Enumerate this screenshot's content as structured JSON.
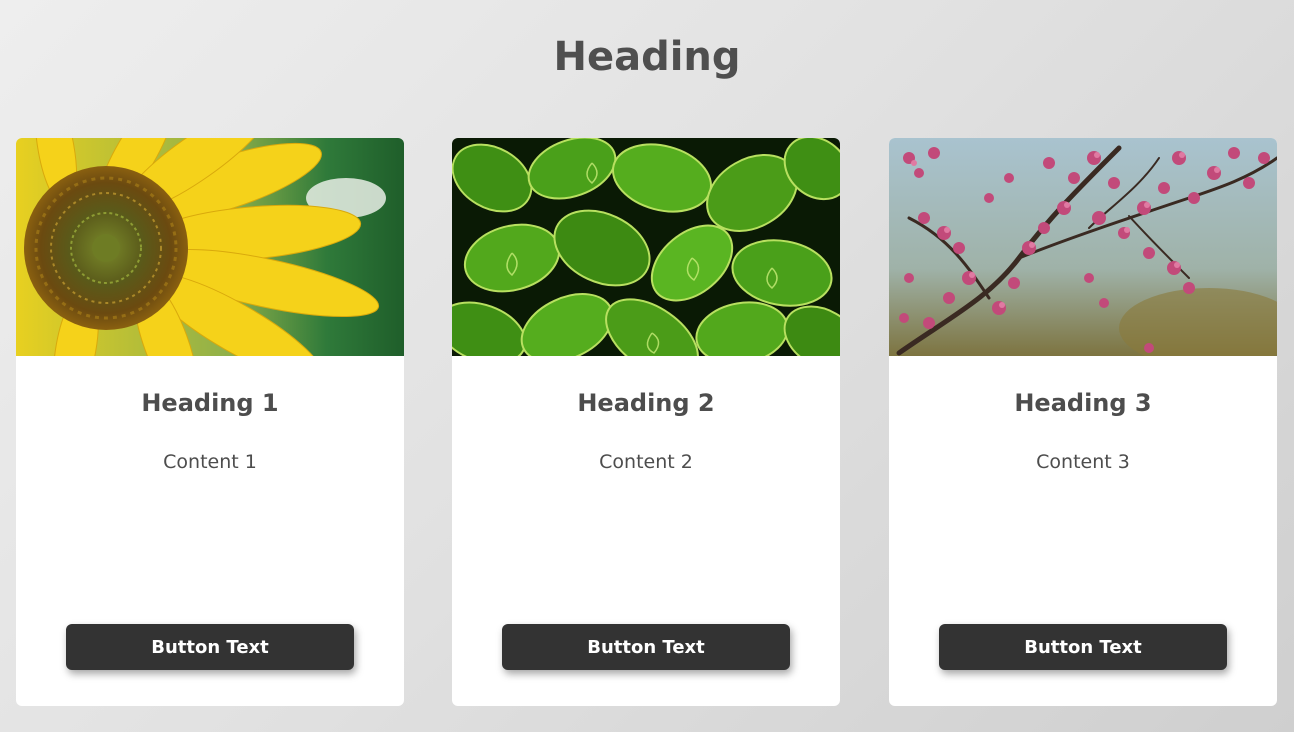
{
  "page": {
    "title": "Heading"
  },
  "cards": [
    {
      "heading": "Heading 1",
      "content": "Content 1",
      "button_label": "Button Text",
      "image": "sunflower"
    },
    {
      "heading": "Heading 2",
      "content": "Content 2",
      "button_label": "Button Text",
      "image": "green-leaves"
    },
    {
      "heading": "Heading 3",
      "content": "Content 3",
      "button_label": "Button Text",
      "image": "pink-blossom-branch"
    }
  ],
  "colors": {
    "button_bg": "#333333",
    "button_text": "#ffffff",
    "text": "#4d4d4d",
    "card_bg": "#ffffff"
  }
}
